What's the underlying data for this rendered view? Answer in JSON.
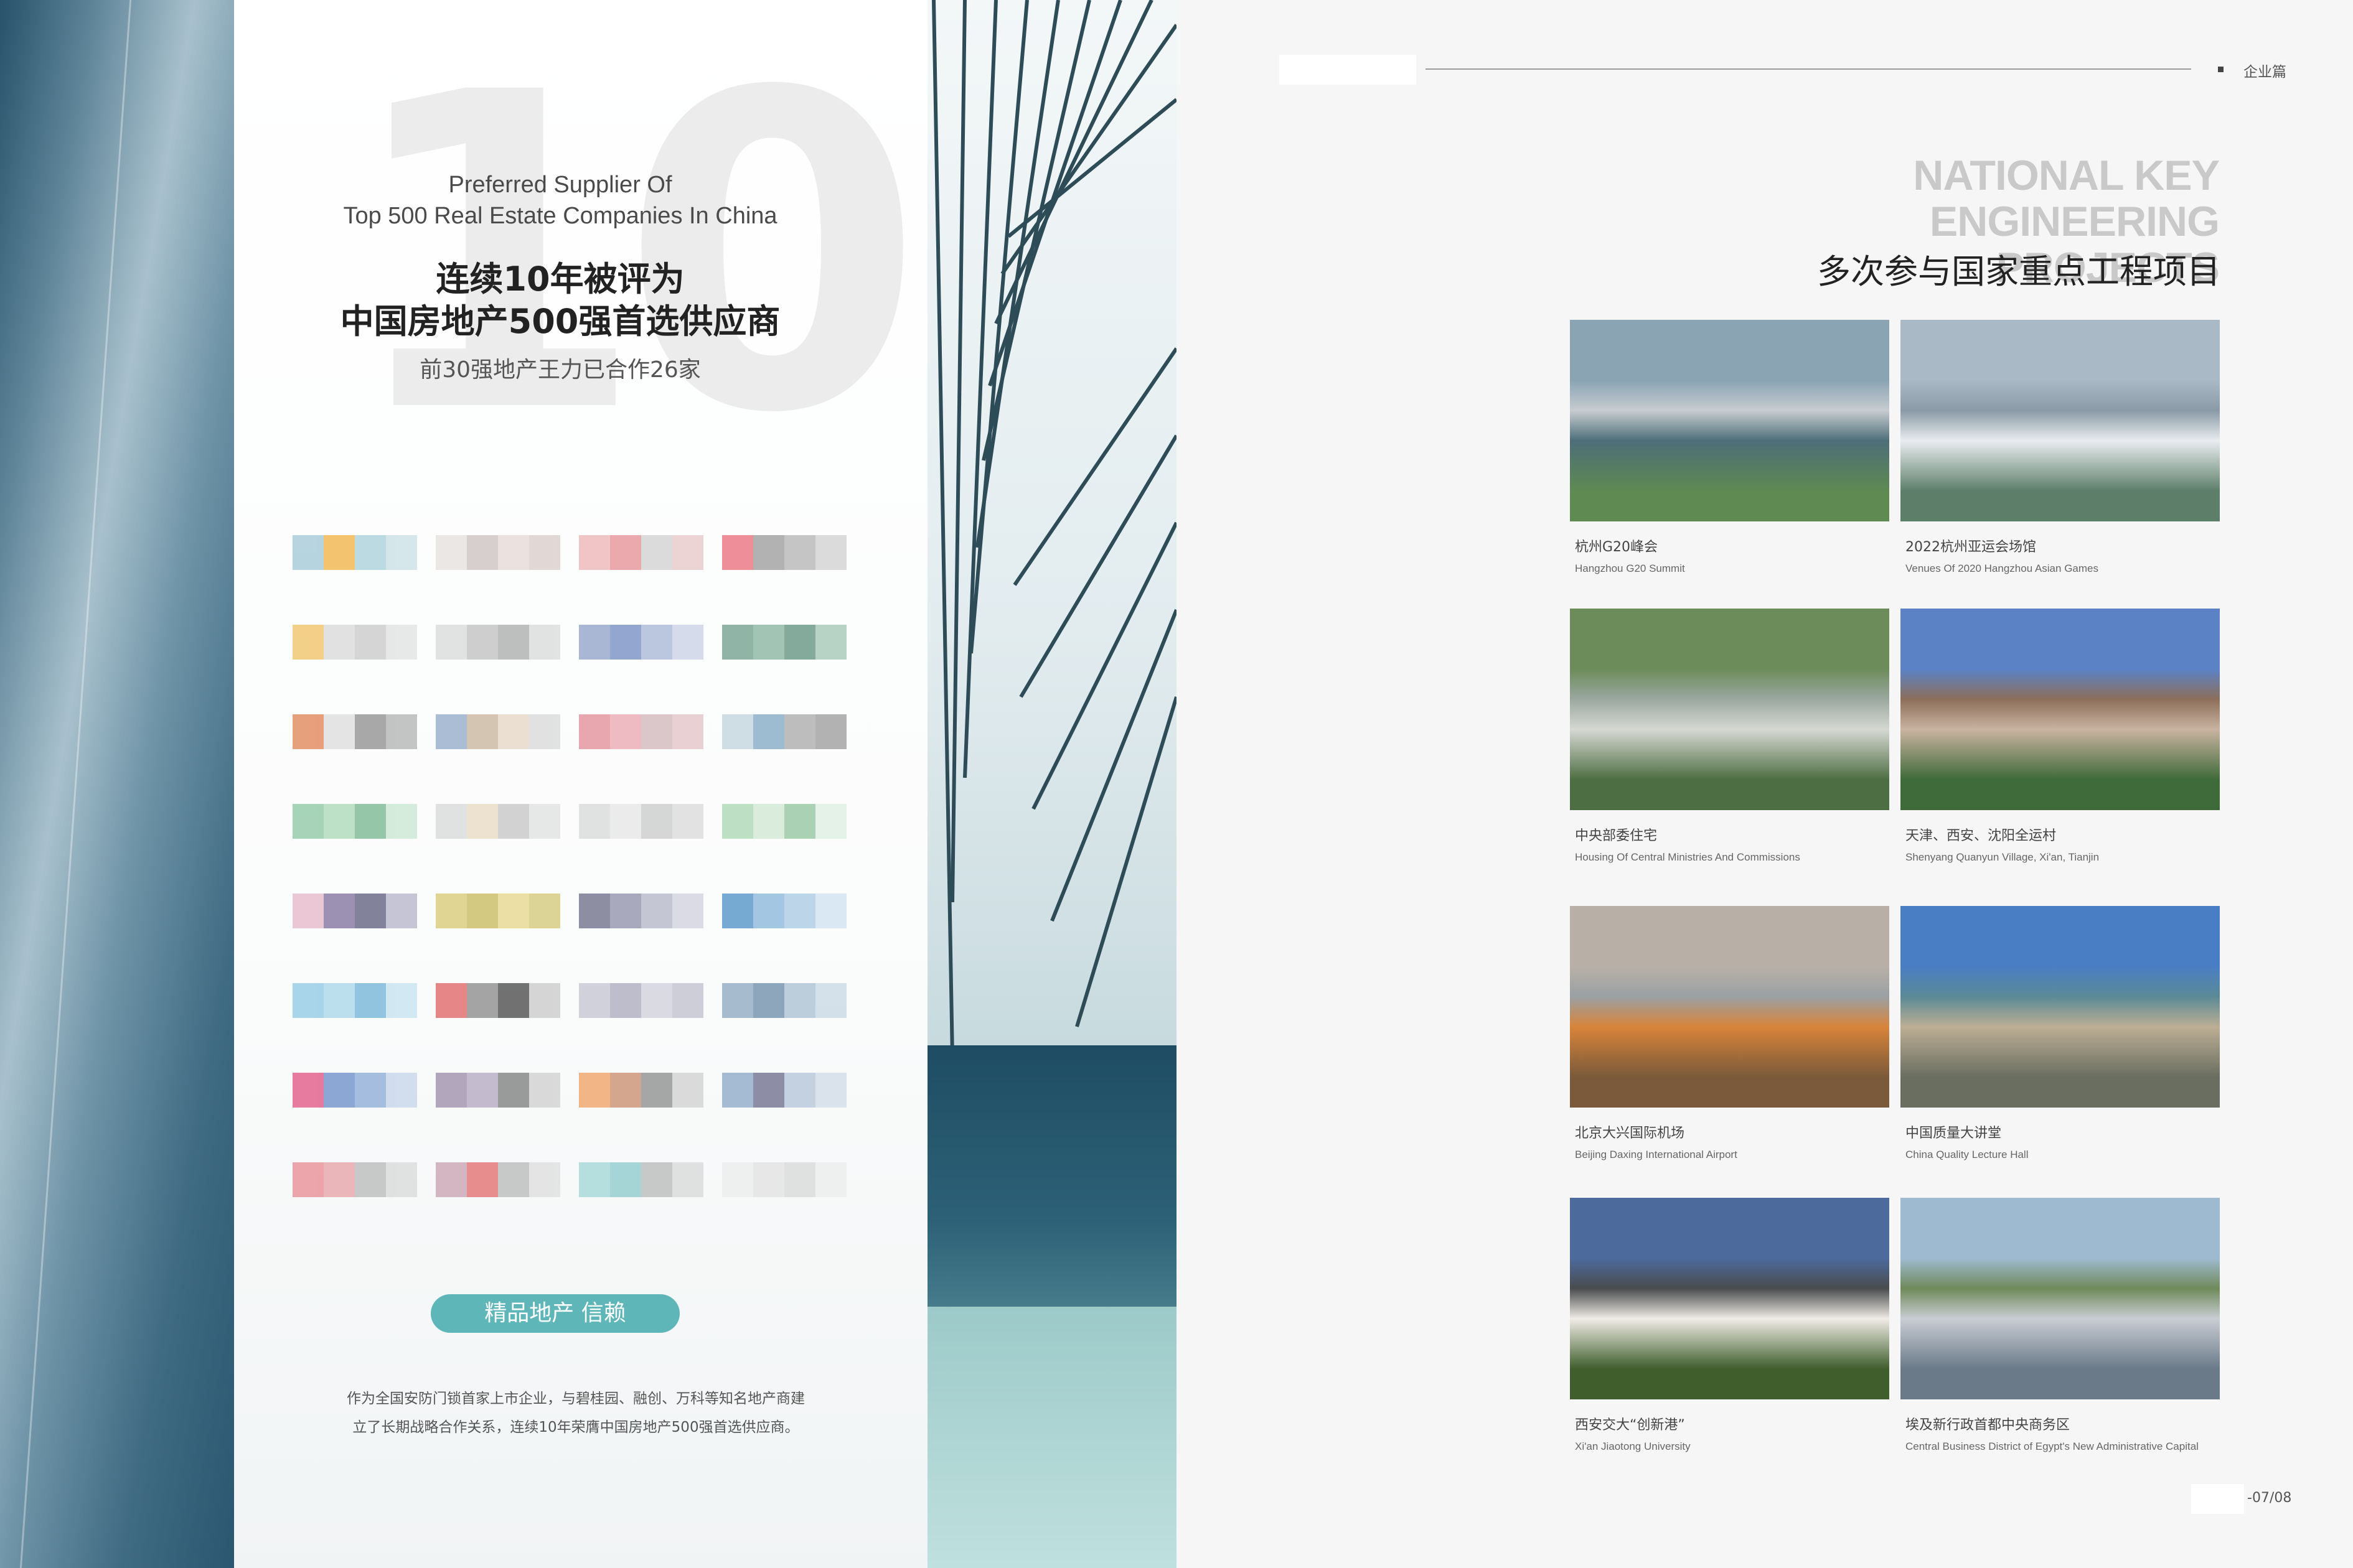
{
  "left": {
    "hero_en_line1": "Preferred Supplier Of",
    "hero_en_line2": "Top 500 Real Estate Companies In China",
    "hero_cn_line1": "连续10年被评为",
    "hero_cn_line2": "中国房地产500强首选供应商",
    "hero_sub": "前30强地产王力已合作26家",
    "big_number": "10",
    "tagline": "精品地产 信赖",
    "desc_line1": "作为全国安防门锁首家上市企业，与碧桂园、融创、万科等知名地产商建",
    "desc_line2": "立了长期战略合作关系，连续10年荣膺中国房地产500强首选供应商。",
    "logo_colors": [
      [
        "#9fc6d6",
        "#f0b040",
        "#a6cfd9",
        "#c8dfe6"
      ],
      [
        "#e6e0de",
        "#c9c0bd",
        "#e5d8d4",
        "#d8cbc8"
      ],
      [
        "#eeb1b4",
        "#e68e93",
        "#d0d0d0",
        "#e7c5c7"
      ],
      [
        "#e86a78",
        "#9a9a9a",
        "#b3b3b3",
        "#d0d0d0"
      ],
      [
        "#f0c060",
        "#d8d8d8",
        "#c8c8c8",
        "#e0e0e0"
      ],
      [
        "#d9d9d9",
        "#bfbfbf",
        "#a9a9a9",
        "#d9d9d9"
      ],
      [
        "#8ea0c8",
        "#6f8ac0",
        "#a6b4d6",
        "#c8d0e4"
      ],
      [
        "#6c9c88",
        "#85b19d",
        "#5d8f7c",
        "#a1c6b4"
      ],
      [
        "#e08050",
        "#dcdcdc",
        "#8c8c8c",
        "#b0b0b0"
      ],
      [
        "#8fa8c8",
        "#c7b39b",
        "#e6d6c4",
        "#d8d8d8"
      ],
      [
        "#e28a94",
        "#e8a6ad",
        "#d0b6ba",
        "#e3c3c6"
      ],
      [
        "#c0d4de",
        "#7ea7c4",
        "#a8a8a8",
        "#9a9a9a"
      ],
      [
        "#8ac6a0",
        "#a7d8b6",
        "#74b48c",
        "#c8e6d2"
      ],
      [
        "#d8d8d8",
        "#e9d9c0",
        "#c4c4c4",
        "#e0e0e0"
      ],
      [
        "#d8d8d8",
        "#e6e6e6",
        "#c9c9c9",
        "#dadada"
      ],
      [
        "#a9d6b0",
        "#cfe8d2",
        "#8fc39b",
        "#dcefe0"
      ],
      [
        "#e5b6c9",
        "#7d6e9a",
        "#5a5a7a",
        "#b3b3c8"
      ],
      [
        "#d8c870",
        "#c8b858",
        "#e6d68a",
        "#d2c676"
      ],
      [
        "#6a6a86",
        "#8e8ea8",
        "#b4b4c6",
        "#d0d0dc"
      ],
      [
        "#4a8fc4",
        "#86b6da",
        "#a9c9e2",
        "#d0e2f0"
      ],
      [
        "#8cc8e4",
        "#a8d6ea",
        "#6fb2d6",
        "#c4e2f0"
      ],
      [
        "#e06060",
        "#888888",
        "#444444",
        "#c9c9c9"
      ],
      [
        "#c4c4d2",
        "#a9a9bc",
        "#d0d0dc",
        "#bfbfcc"
      ],
      [
        "#8aa8bf",
        "#6a8aa6",
        "#a8c0d2",
        "#c8d8e4"
      ],
      [
        "#e05080",
        "#6a8cc8",
        "#8aaad8",
        "#c4d4ea"
      ],
      [
        "#9a8aa8",
        "#b2a6bf",
        "#7a7a7a",
        "#cfcfcf"
      ],
      [
        "#f0a060",
        "#c88a6a",
        "#8a8a8a",
        "#d0d0d0"
      ],
      [
        "#8aa6c8",
        "#6a6a8a",
        "#b2c4d8",
        "#d0dae6"
      ],
      [
        "#e88a90",
        "#e6a0a6",
        "#b8b8b8",
        "#d8d8d8"
      ],
      [
        "#c8a0b0",
        "#e46a6a",
        "#b8b8b8",
        "#dedede"
      ],
      [
        "#a0d6d6",
        "#8acaca",
        "#b8b8b8",
        "#d8d8d8"
      ],
      [
        "#ececec",
        "#e2e2e2",
        "#d8d8d8",
        "#ececec"
      ]
    ]
  },
  "right": {
    "header_section": "企业篇",
    "title_en_line1": "NATIONAL KEY",
    "title_en_line2": "ENGINEERING PROJECTS",
    "title_cn": "多次参与国家重点工程项目",
    "page_number": "-07/08",
    "projects": [
      {
        "cn": "杭州G20峰会",
        "en": "Hangzhou G20 Summit",
        "palette": [
          "#8aa4b4",
          "#4d6e78",
          "#5f8a52",
          "#c7ccd0"
        ]
      },
      {
        "cn": "2022杭州亚运会场馆",
        "en": "Venues Of 2020 Hangzhou Asian Games",
        "palette": [
          "#a9b9c6",
          "#e9ecef",
          "#5d7f6a",
          "#8a9aa6"
        ]
      },
      {
        "cn": "中央部委住宅",
        "en": "Housing Of Central Ministries And Commissions",
        "palette": [
          "#6c8c5a",
          "#d6d8d2",
          "#4d6e42",
          "#9aa8a0"
        ]
      },
      {
        "cn": "天津、西安、沈阳全运村",
        "en": "Shenyang Quanyun Village, Xi'an, Tianjin",
        "palette": [
          "#5c82c6",
          "#c9b3a0",
          "#3f6a3a",
          "#8c6f5a"
        ]
      },
      {
        "cn": "北京大兴国际机场",
        "en": "Beijing Daxing International Airport",
        "palette": [
          "#b8b0a6",
          "#d8843a",
          "#7a5a3a",
          "#9aa0a4"
        ]
      },
      {
        "cn": "中国质量大讲堂",
        "en": "China Quality Lecture Hall",
        "palette": [
          "#4a7ec4",
          "#bcae94",
          "#6a6e60",
          "#5a8a96"
        ]
      },
      {
        "cn": "西安交大“创新港”",
        "en": "Xi'an Jiaotong University",
        "palette": [
          "#4c6a9c",
          "#f0ece6",
          "#3f5e2c",
          "#4a4c4e"
        ]
      },
      {
        "cn": "埃及新行政首都中央商务区",
        "en": "Central Business District of Egypt's New Administrative Capital",
        "palette": [
          "#9ebad0",
          "#c9cdd4",
          "#6a7a88",
          "#6f8a5a"
        ]
      }
    ]
  }
}
